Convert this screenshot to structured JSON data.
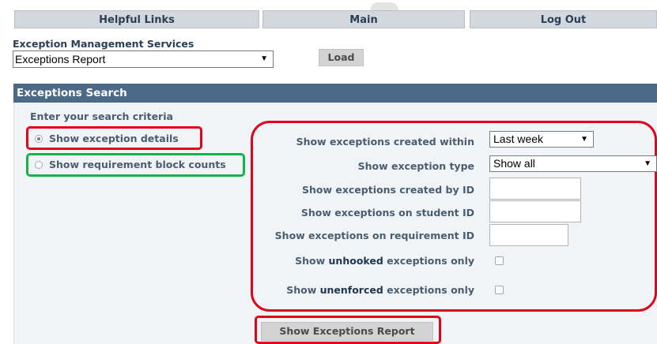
{
  "nav": {
    "helpful_links": "Helpful Links",
    "main": "Main",
    "log_out": "Log Out"
  },
  "service": {
    "label": "Exception Management Services",
    "selected_report": "Exceptions Report",
    "load_label": "Load"
  },
  "search": {
    "header": "Exceptions Search",
    "criteria_label": "Enter your search criteria",
    "radio_details": "Show exception details",
    "radio_counts": "Show requirement block counts",
    "created_within_label": "Show exceptions created within",
    "created_within_value": "Last week",
    "type_label": "Show exception type",
    "type_value": "Show all",
    "created_by_label": "Show exceptions created by ID",
    "created_by_value": "",
    "student_label": "Show exceptions on student ID",
    "student_value": "",
    "requirement_label": "Show exceptions on requirement ID",
    "requirement_value": "",
    "unhooked_prefix": "Show ",
    "unhooked_word": "unhooked",
    "unhooked_suffix": " exceptions only",
    "unenforced_prefix": "Show ",
    "unenforced_word": "unenforced",
    "unenforced_suffix": " exceptions only",
    "submit_label": "Show Exceptions Report"
  },
  "colors": {
    "header_bg": "#4a6a88",
    "highlight_red": "#e3001b",
    "highlight_green": "#16b34a"
  }
}
